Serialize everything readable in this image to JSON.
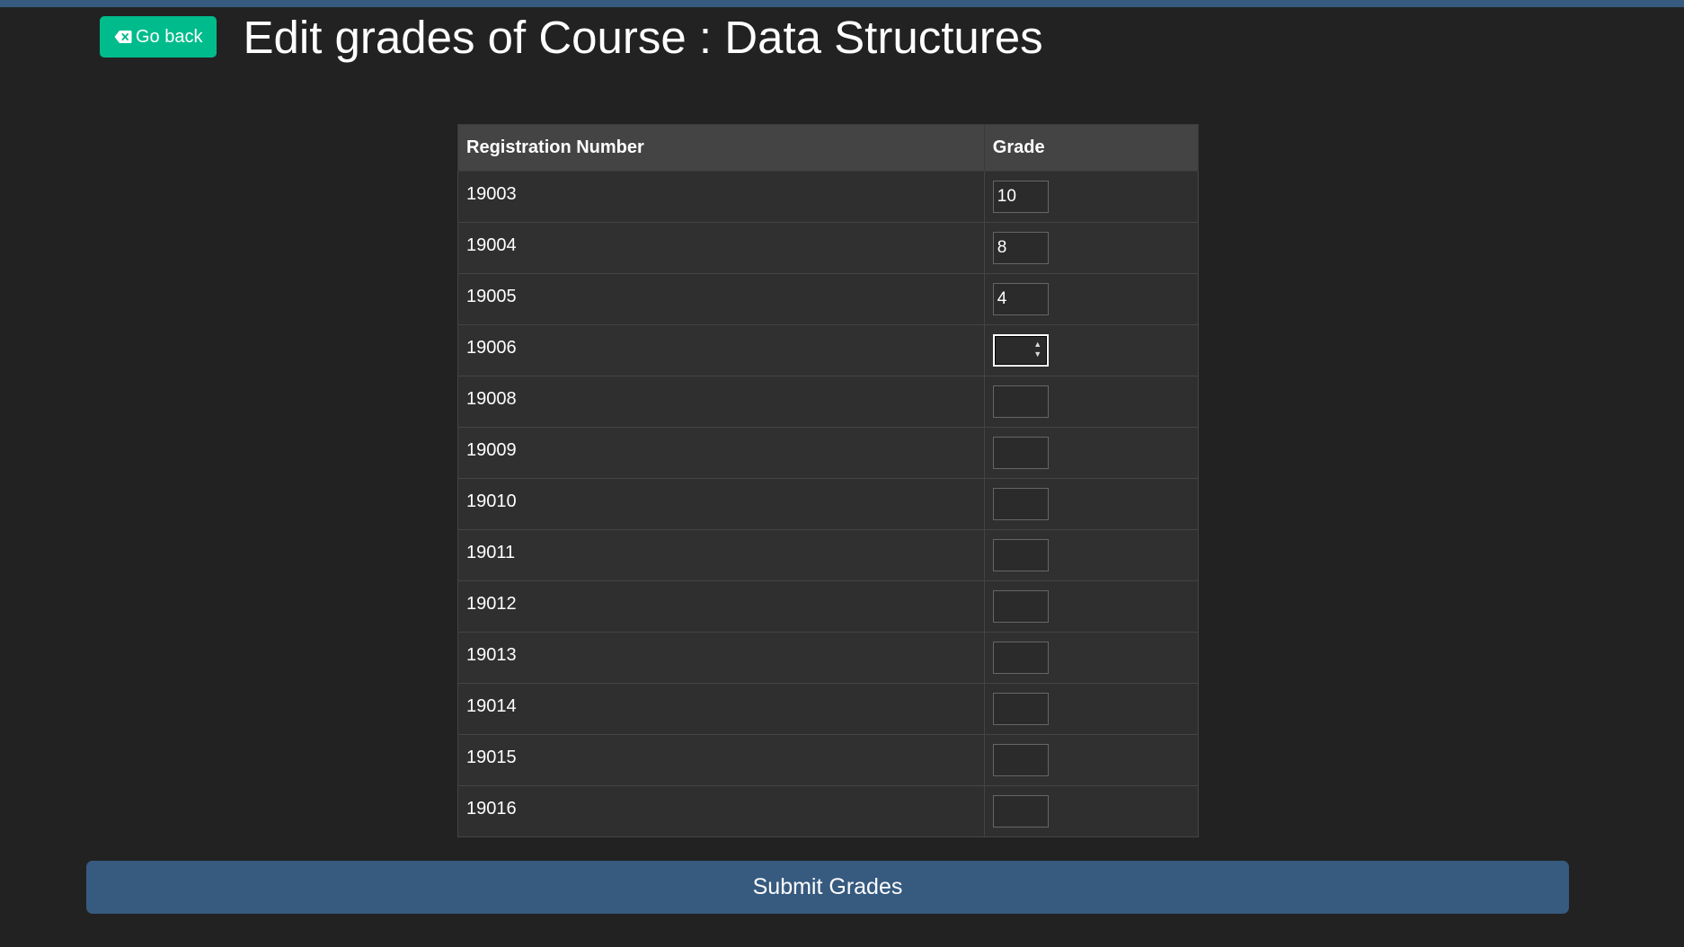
{
  "header": {
    "back_label": "Go back",
    "back_icon": "backspace-icon",
    "title": "Edit grades of Course : Data Structures"
  },
  "table": {
    "columns": [
      "Registration Number",
      "Grade"
    ],
    "rows": [
      {
        "reg": "19003",
        "grade": "10"
      },
      {
        "reg": "19004",
        "grade": "8"
      },
      {
        "reg": "19005",
        "grade": "4"
      },
      {
        "reg": "19006",
        "grade": ""
      },
      {
        "reg": "19008",
        "grade": ""
      },
      {
        "reg": "19009",
        "grade": ""
      },
      {
        "reg": "19010",
        "grade": ""
      },
      {
        "reg": "19011",
        "grade": ""
      },
      {
        "reg": "19012",
        "grade": ""
      },
      {
        "reg": "19013",
        "grade": ""
      },
      {
        "reg": "19014",
        "grade": ""
      },
      {
        "reg": "19015",
        "grade": ""
      },
      {
        "reg": "19016",
        "grade": ""
      }
    ]
  },
  "submit_label": "Submit Grades",
  "colors": {
    "background": "#222222",
    "accent_green": "#00bc8c",
    "primary_blue": "#375a7f"
  }
}
